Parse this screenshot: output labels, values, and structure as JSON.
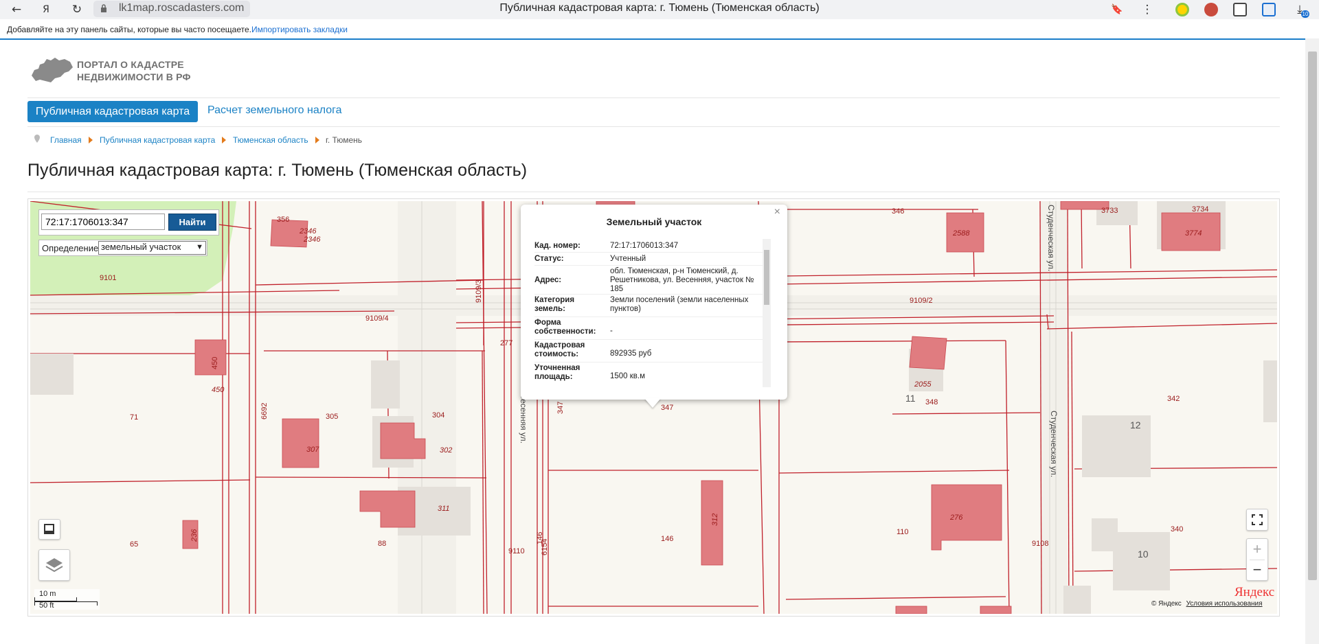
{
  "browser": {
    "back_icon": "arrow-left-icon",
    "url": "lk1map.roscadasters.com",
    "tab_title": "Публичная кадастровая карта: г. Тюмень (Тюменская область)",
    "bookmarks_hint": "Добавляйте на эту панель сайты, которые вы часто посещаете.",
    "import_link": "Импортировать закладки",
    "downloads_badge": "10"
  },
  "portal": {
    "logo_line1": "ПОРТАЛ О КАДАСТРЕ",
    "logo_line2": "НЕДВИЖИМОСТИ В РФ",
    "tabs": [
      {
        "label": "Публичная кадастровая карта",
        "active": true
      },
      {
        "label": "Расчет земельного налога",
        "active": false
      }
    ],
    "breadcrumb": [
      "Главная",
      "Публичная кадастровая карта",
      "Тюменская область",
      "г. Тюмень"
    ],
    "title": "Публичная кадастровая карта: г. Тюмень (Тюменская область)"
  },
  "map": {
    "search_value": "72:17:1706013:347",
    "find_button": "Найти",
    "definition_label": "Определение:",
    "definition_value": "земельный участок",
    "scale_metric": "10 m",
    "scale_imperial": "50 ft",
    "yandex_logo": "Яндекс",
    "copyright": "© Яндекс",
    "terms_link": "Условия использования",
    "streets": [
      "Весенняя ул.",
      "Студенческая ул.",
      "Студенческая ул."
    ],
    "labels": [
      "9101",
      "9109/4",
      "356",
      "2346",
      "2346",
      "9109/3",
      "277",
      "450",
      "450",
      "71",
      "6692",
      "305",
      "307",
      "304",
      "302",
      "347",
      "311",
      "88",
      "65",
      "236",
      "146",
      "6154",
      "9110",
      "146",
      "312",
      "347",
      "346",
      "2588",
      "9109/2",
      "2055",
      "11",
      "348",
      "276",
      "110",
      "9108",
      "3733",
      "3734",
      "3774",
      "342",
      "12",
      "340",
      "10"
    ]
  },
  "popup": {
    "title": "Земельный участок",
    "rows": [
      {
        "key": "Кад. номер:",
        "value": "72:17:1706013:347"
      },
      {
        "key": "Статус:",
        "value": "Учтенный"
      },
      {
        "key": "Адрес:",
        "value": "обл. Тюменская, р-н Тюменский, д. Решетникова, ул. Весенняя, участок № 185"
      },
      {
        "key": "Категория земель:",
        "value": "Земли поселений (земли населенных пунктов)"
      },
      {
        "key": "Форма собственности:",
        "value": "-"
      },
      {
        "key": "Кадастровая стоимость:",
        "value": "892935 руб"
      },
      {
        "key": "Уточненная площадь:",
        "value": "1500 кв.м"
      }
    ]
  }
}
